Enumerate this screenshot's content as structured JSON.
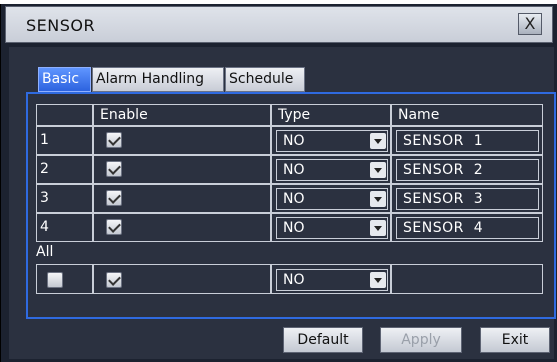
{
  "dialog": {
    "title": "SENSOR",
    "close_glyph": "X"
  },
  "tabs": [
    {
      "label": "Basic",
      "active": true
    },
    {
      "label": "Alarm Handling",
      "active": false
    },
    {
      "label": "Schedule",
      "active": false
    }
  ],
  "table": {
    "headers": {
      "num": "",
      "enable": "Enable",
      "type": "Type",
      "name": "Name"
    },
    "rows": [
      {
        "num": "1",
        "enabled": true,
        "type": "NO",
        "name": "SENSOR  1"
      },
      {
        "num": "2",
        "enabled": true,
        "type": "NO",
        "name": "SENSOR  2"
      },
      {
        "num": "3",
        "enabled": true,
        "type": "NO",
        "name": "SENSOR  3"
      },
      {
        "num": "4",
        "enabled": true,
        "type": "NO",
        "name": "SENSOR  4"
      }
    ],
    "all_label": "All",
    "all_row": {
      "select_all_checked": false,
      "enabled": true,
      "type": "NO"
    }
  },
  "buttons": {
    "default": "Default",
    "apply": "Apply",
    "exit": "Exit"
  },
  "icons": {
    "close": "close-icon",
    "dropdown": "chevron-down-icon",
    "checkbox": "checkbox-icon"
  },
  "colors": {
    "accent": "#2f6ae0",
    "active_tab": "#3a70e8",
    "background": "#2b3140"
  }
}
